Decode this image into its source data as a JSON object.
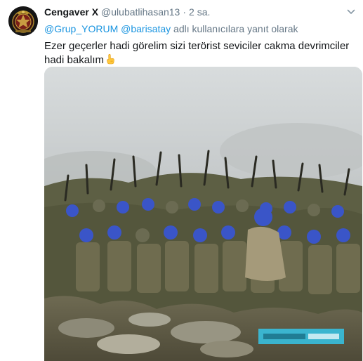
{
  "tweet": {
    "display_name": "Cengaver X",
    "handle": "@ulubatlihasan13",
    "separator": "·",
    "time": "2 sa.",
    "reply_to": {
      "mention_1": "@Grup_YORUM",
      "mention_2": "@barisatay",
      "suffix": "adlı kullanıcılara yanıt olarak"
    },
    "text": "Ezer geçerler hadi görelim sizi terörist seviciler cakma devrimciler hadi bakalım",
    "emoji": "backhand-index-pointing-up"
  },
  "media": {
    "type": "video-still",
    "subject": "crowd of soldiers with blue berets raising rifles",
    "overlay_caption_color": "#35c6e8"
  },
  "icons": {
    "caret": "chevron-down-icon",
    "avatar": "emblem-avatar"
  },
  "colors": {
    "name": "#14171a",
    "secondary": "#657786",
    "link": "#1b95e0",
    "beret": "#3a55c8"
  }
}
